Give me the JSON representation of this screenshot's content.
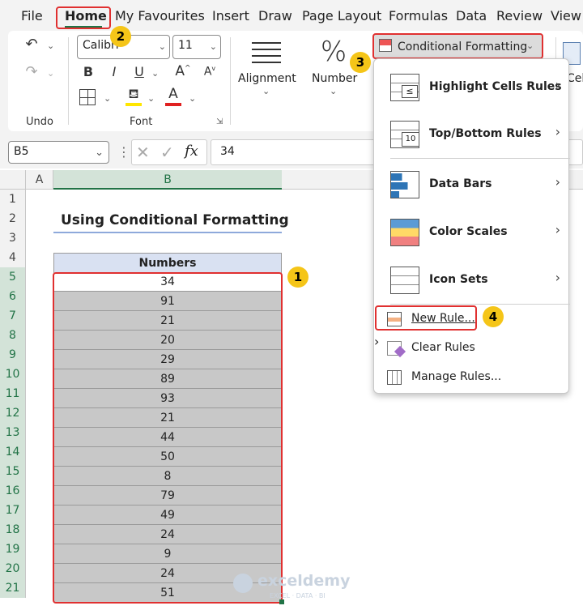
{
  "tabs": [
    {
      "label": "File"
    },
    {
      "label": "Home"
    },
    {
      "label": "My Favourites"
    },
    {
      "label": "Insert"
    },
    {
      "label": "Draw"
    },
    {
      "label": "Page Layout"
    },
    {
      "label": "Formulas"
    },
    {
      "label": "Data"
    },
    {
      "label": "Review"
    },
    {
      "label": "View"
    }
  ],
  "ribbon": {
    "undo_label": "Undo",
    "font_group_label": "Font",
    "font_name": "Calibri",
    "font_size": "11",
    "alignment_label": "Alignment",
    "number_label": "Number",
    "cond_format_label": "Conditional Formatting",
    "cells_partial": "Cel"
  },
  "formula_bar": {
    "name_box": "B5",
    "fx": "fx",
    "value": "34"
  },
  "columns": [
    "A",
    "B"
  ],
  "rows": [
    "1",
    "2",
    "3",
    "4",
    "5",
    "6",
    "7",
    "8",
    "9",
    "10",
    "11",
    "12",
    "13",
    "14",
    "15",
    "16",
    "17",
    "18",
    "19",
    "20",
    "21"
  ],
  "sheet": {
    "title": "Using Conditional Formatting",
    "header": "Numbers",
    "values": [
      "34",
      "91",
      "21",
      "20",
      "29",
      "89",
      "93",
      "21",
      "44",
      "50",
      "8",
      "79",
      "49",
      "24",
      "9",
      "24",
      "51"
    ]
  },
  "menu": {
    "items": [
      {
        "label": "Highlight Cells Rules"
      },
      {
        "label": "Top/Bottom Rules"
      },
      {
        "label": "Data Bars"
      },
      {
        "label": "Color Scales"
      },
      {
        "label": "Icon Sets"
      }
    ],
    "new_rule": "New Rule...",
    "clear_rules": "Clear Rules",
    "manage_rules": "Manage Rules..."
  },
  "badges": [
    "1",
    "2",
    "3",
    "4"
  ],
  "watermark": "exceldemy",
  "watermark_sub": "EXCEL · DATA · BI",
  "colors": {
    "accent": "#217346",
    "highlight_red": "#e03030",
    "badge": "#f5c518",
    "selected_fill": "#c8c8c8"
  }
}
